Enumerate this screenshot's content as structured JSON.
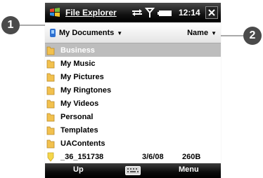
{
  "titlebar": {
    "app_title": "File Explorer",
    "clock": "12:14",
    "icons": [
      "windows-start-icon",
      "data-connection-icon",
      "signal-strength-icon",
      "battery-icon",
      "close-icon"
    ]
  },
  "header": {
    "folder_label": "My Documents",
    "sort_label": "Name"
  },
  "files": [
    {
      "name": "Business",
      "type": "folder",
      "selected": true
    },
    {
      "name": "My Music",
      "type": "folder"
    },
    {
      "name": "My Pictures",
      "type": "folder"
    },
    {
      "name": "My Ringtones",
      "type": "folder"
    },
    {
      "name": "My Videos",
      "type": "folder"
    },
    {
      "name": "Personal",
      "type": "folder"
    },
    {
      "name": "Templates",
      "type": "folder"
    },
    {
      "name": "UAContents",
      "type": "folder"
    },
    {
      "name": "_36_151738",
      "type": "file",
      "date": "3/6/08",
      "size": "260B"
    }
  ],
  "softkeys": {
    "left": "Up",
    "right": "Menu"
  },
  "callouts": [
    "1",
    "2"
  ],
  "colors": {
    "selection": "#bdbdbd",
    "folder": "#f2c14e",
    "callout": "#4a4a4a"
  }
}
